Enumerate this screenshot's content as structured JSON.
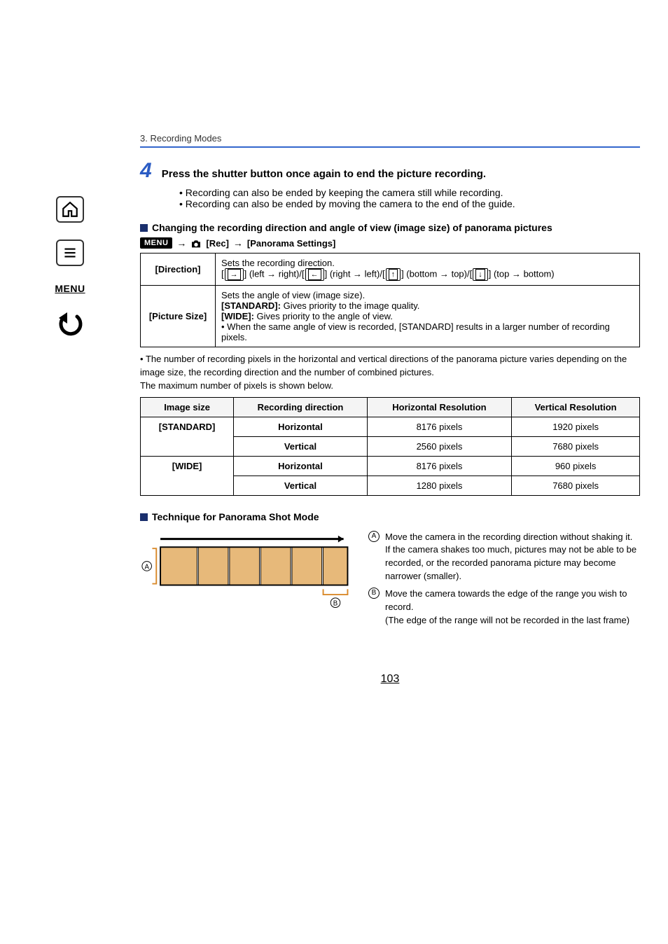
{
  "sidebar": {
    "menu_label": "MENU"
  },
  "chapter": "3. Recording Modes",
  "step": {
    "number": "4",
    "text": "Press the shutter button once again to end the picture recording.",
    "bullets": [
      "Recording can also be ended by keeping the camera still while recording.",
      "Recording can also be ended by moving the camera to the end of the guide."
    ]
  },
  "heading1": "Changing the recording direction and angle of view (image size) of panorama pictures",
  "menu_path": {
    "menu_badge": "MENU",
    "rec": "[Rec]",
    "panorama": "[Panorama Settings]"
  },
  "settings_table": {
    "direction": {
      "label": "[Direction]",
      "intro": "Sets the recording direction.",
      "seq_prefix": "[",
      "lr": "] (left → right)/[",
      "rl": "] (right → left)/[",
      "bt": "] (bottom → top)/[",
      "tb": "] (top → bottom)"
    },
    "picsize": {
      "label": "[Picture Size]",
      "l1": "Sets the angle of view (image size).",
      "l2a": "[STANDARD]:",
      "l2b": " Gives priority to the image quality.",
      "l3a": "[WIDE]:",
      "l3b": " Gives priority to the angle of view.",
      "l4": "When the same angle of view is recorded, [STANDARD] results in a larger number of recording pixels."
    }
  },
  "note": "The number of recording pixels in the horizontal and vertical directions of the panorama picture varies depending on the image size, the recording direction and the number of combined pictures.",
  "note2": "The maximum number of pixels is shown below.",
  "pixel_table": {
    "headers": [
      "Image size",
      "Recording direction",
      "Horizontal Resolution",
      "Vertical Resolution"
    ],
    "rows": [
      {
        "size": "[STANDARD]",
        "dir": "Horizontal",
        "h": "8176 pixels",
        "v": "1920 pixels"
      },
      {
        "size": "[STANDARD]",
        "dir": "Vertical",
        "h": "2560 pixels",
        "v": "7680 pixels"
      },
      {
        "size": "[WIDE]",
        "dir": "Horizontal",
        "h": "8176 pixels",
        "v": "960 pixels"
      },
      {
        "size": "[WIDE]",
        "dir": "Vertical",
        "h": "1280 pixels",
        "v": "7680 pixels"
      }
    ]
  },
  "heading2": "Technique for Panorama Shot Mode",
  "labels": {
    "A": "A",
    "B": "B"
  },
  "explain": {
    "A": "Move the camera in the recording direction without shaking it.",
    "A2": "If the camera shakes too much, pictures may not be able to be recorded, or the recorded panorama picture may become narrower (smaller).",
    "B": "Move the camera towards the edge of the range you wish to record.",
    "B2": "(The edge of the range will not be recorded in the last frame)"
  },
  "page_number": "103"
}
